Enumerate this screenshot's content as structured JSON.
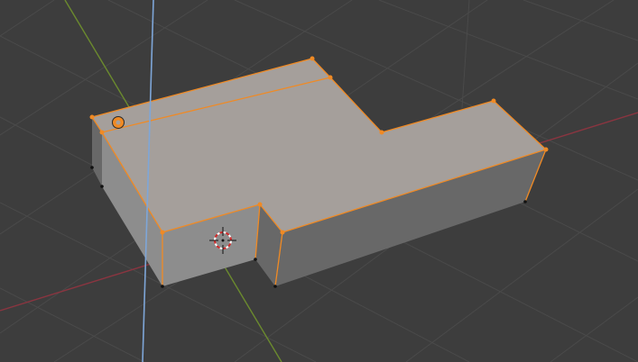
{
  "viewport": {
    "mode": "3d-viewport-edit-mode",
    "background_color": "#3d3d3d",
    "grid_line_color": "#4a4a4a",
    "axis_x_color": "#8a3540",
    "axis_y_color": "#6b8a2e",
    "axis_z_color": "#7ea6d8",
    "mesh_top_color": "#a59f9b",
    "mesh_front_color": "#8d8d8d",
    "mesh_side_color": "#686868",
    "selection_color": "#f08a24",
    "vertex_unselected_color": "#111111"
  },
  "icons": {
    "origin": "object-origin-icon",
    "cursor": "3d-cursor-icon"
  }
}
